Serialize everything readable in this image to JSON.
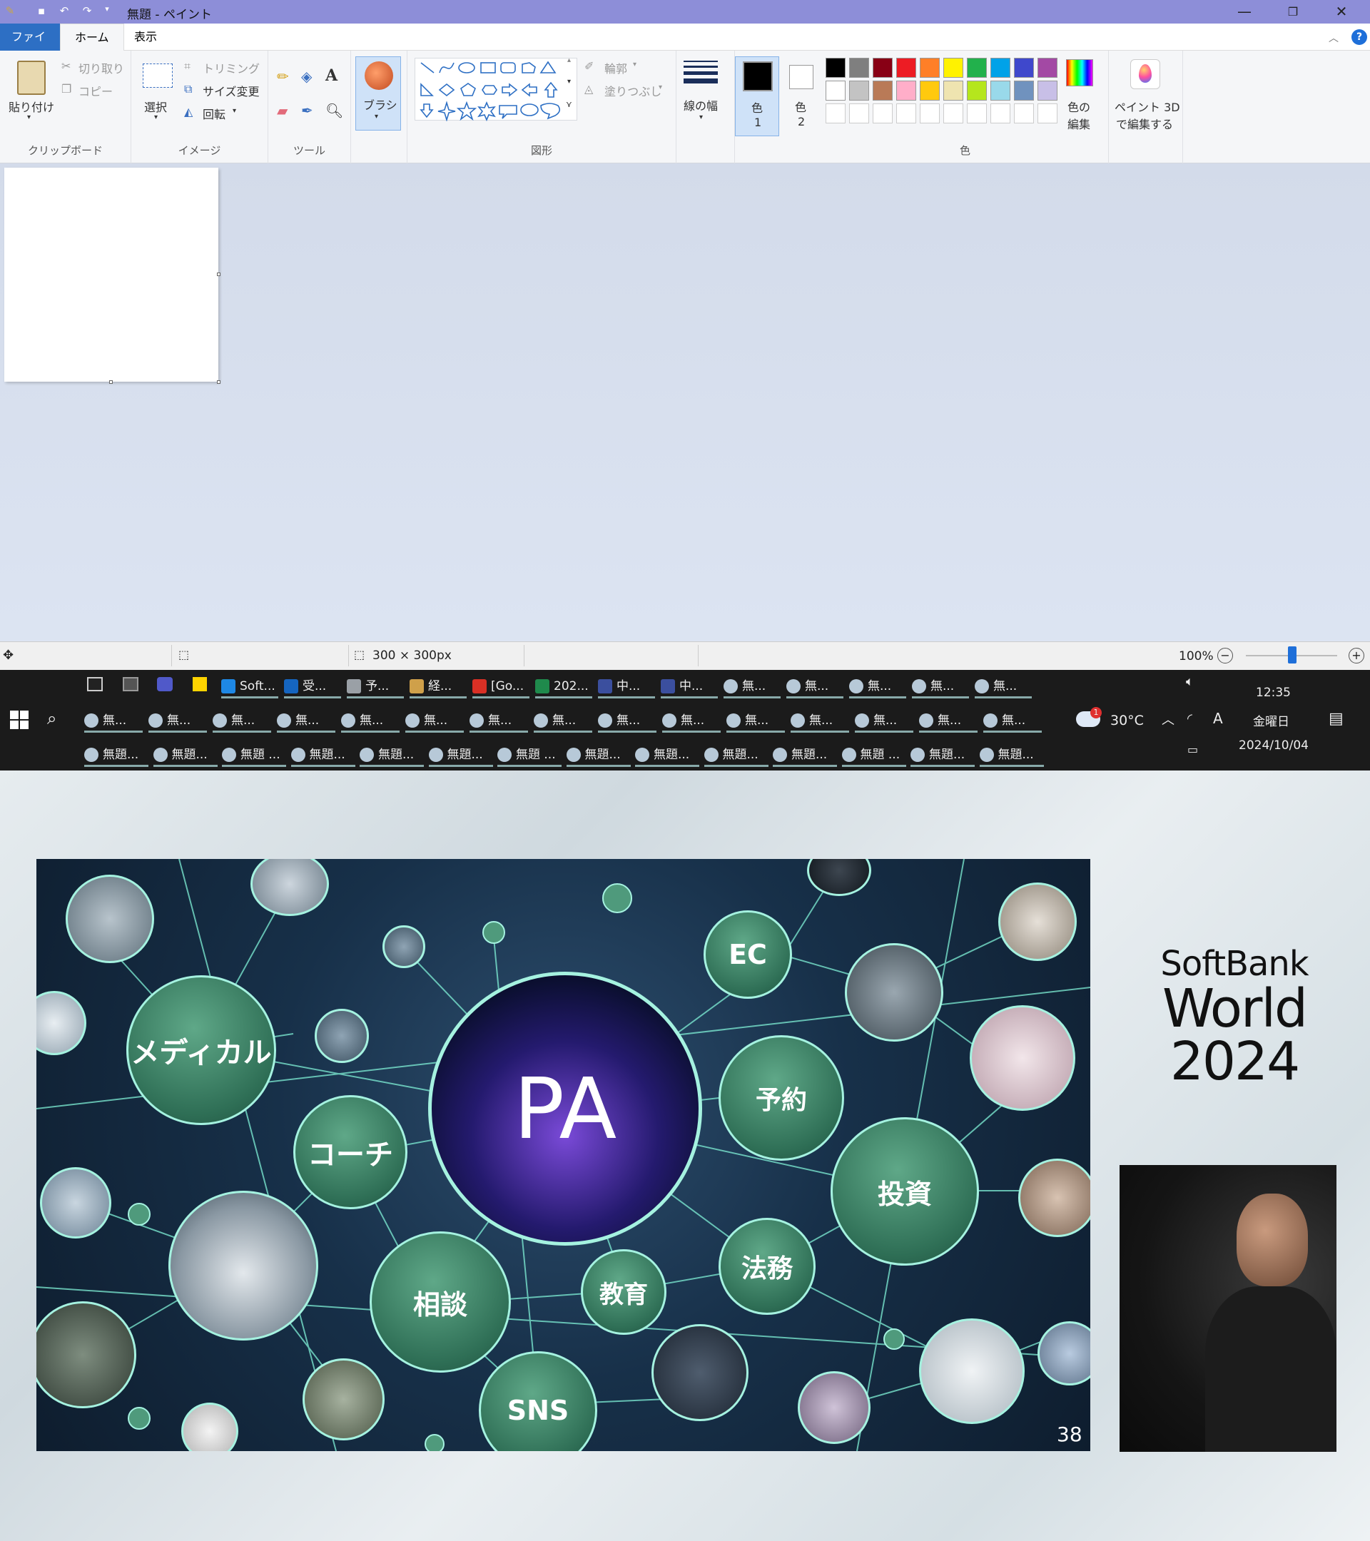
{
  "window": {
    "title": "無題 - ペイント"
  },
  "tabs": {
    "file": "ファイル",
    "home": "ホーム",
    "view": "表示"
  },
  "ribbon": {
    "clipboard": {
      "paste": "貼り付け",
      "cut": "切り取り",
      "copy": "コピー",
      "label": "クリップボード"
    },
    "image": {
      "select": "選択",
      "crop": "トリミング",
      "resize": "サイズ変更",
      "rotate": "回転",
      "label": "イメージ"
    },
    "tools": {
      "label": "ツール"
    },
    "brush": {
      "label": "ブラシ"
    },
    "shapes": {
      "outline": "輪郭",
      "fill": "塗りつぶし",
      "label": "図形"
    },
    "size": {
      "label": "線の幅"
    },
    "color1": {
      "label1": "色",
      "label2": "1"
    },
    "color2": {
      "label1": "色",
      "label2": "2"
    },
    "colors": {
      "label": "色",
      "edit1": "色の",
      "edit2": "編集"
    },
    "paint3d": {
      "line1": "ペイント 3D",
      "line2": "で編集する"
    },
    "palette_row1": [
      "#000000",
      "#7f7f7f",
      "#880015",
      "#ed1c24",
      "#ff7f27",
      "#fff200",
      "#22b14c",
      "#00a2e8",
      "#3f48cc",
      "#a349a4"
    ],
    "palette_row2": [
      "#ffffff",
      "#c3c3c3",
      "#b97a57",
      "#ffaec9",
      "#ffc90e",
      "#efe4b0",
      "#b5e61d",
      "#99d9ea",
      "#7092be",
      "#c8bfe7"
    ]
  },
  "status": {
    "canvas_size": "300 × 300px",
    "zoom": "100%"
  },
  "taskbar": {
    "row1": [
      "Soft...",
      "受...",
      "予...",
      "経...",
      "[Go...",
      "202...",
      "中...",
      "中...",
      "無...",
      "無...",
      "無...",
      "無...",
      "無..."
    ],
    "row2": [
      "無...",
      "無...",
      "無...",
      "無...",
      "無...",
      "無...",
      "無...",
      "無...",
      "無...",
      "無...",
      "無...",
      "無...",
      "無...",
      "無...",
      "無..."
    ],
    "row3": [
      "無題...",
      "無題...",
      "無題 ...",
      "無題...",
      "無題...",
      "無題...",
      "無題 ...",
      "無題...",
      "無題...",
      "無題...",
      "無題...",
      "無題 ...",
      "無題...",
      "無題..."
    ],
    "weather": "30°C",
    "weather_badge": "1",
    "time": "12:35",
    "day": "金曜日",
    "date": "2024/10/04"
  },
  "slide": {
    "center": "PA",
    "bubbles": [
      "メディカル",
      "コーチ",
      "相談",
      "SNS",
      "教育",
      "法務",
      "予約",
      "EC",
      "投資"
    ],
    "page": "38"
  },
  "brand": {
    "line1": "SoftBank",
    "line2": "World",
    "line3": "2024"
  }
}
